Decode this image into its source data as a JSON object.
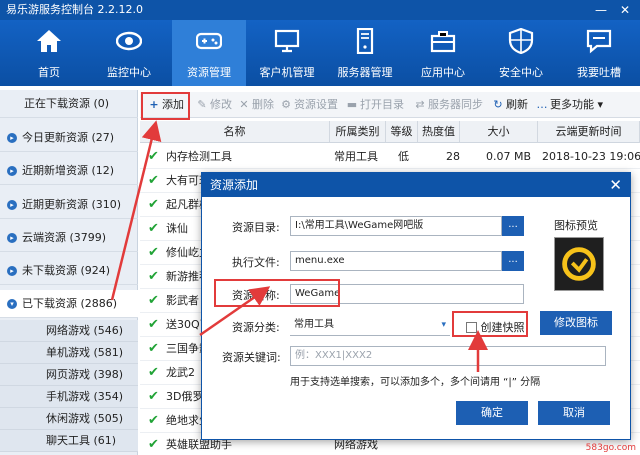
{
  "app": {
    "title": "易乐游服务控制台 2.2.12.0",
    "minimize": "—",
    "close": "✕"
  },
  "nav": [
    {
      "label": "首页",
      "icon": "home-icon"
    },
    {
      "label": "监控中心",
      "icon": "eye-icon"
    },
    {
      "label": "资源管理",
      "icon": "gamepad-icon"
    },
    {
      "label": "客户机管理",
      "icon": "monitor-icon"
    },
    {
      "label": "服务器管理",
      "icon": "server-icon"
    },
    {
      "label": "应用中心",
      "icon": "briefcase-icon"
    },
    {
      "label": "安全中心",
      "icon": "shield-icon"
    },
    {
      "label": "我要吐槽",
      "icon": "chat-icon"
    }
  ],
  "sidebar": {
    "items": [
      {
        "label": "正在下载资源 (0)",
        "kind": "header"
      },
      {
        "label": "今日更新资源 (27)"
      },
      {
        "label": "近期新增资源 (12)"
      },
      {
        "label": "近期更新资源 (310)"
      },
      {
        "label": "云端资源 (3799)"
      },
      {
        "label": "未下载资源 (924)"
      },
      {
        "label": "已下载资源 (2886)",
        "selected": true
      }
    ],
    "subitems": [
      {
        "label": "网络游戏 (546)"
      },
      {
        "label": "单机游戏 (581)"
      },
      {
        "label": "网页游戏 (398)"
      },
      {
        "label": "手机游戏 (354)"
      },
      {
        "label": "休闲游戏 (505)"
      },
      {
        "label": "聊天工具 (61)"
      }
    ]
  },
  "toolbar": {
    "add": "添加",
    "modify": "修改",
    "delete": "删除",
    "settings": "资源设置",
    "open_dir": "打开目录",
    "sync": "服务器同步",
    "refresh": "刷新",
    "more": "更多功能"
  },
  "table": {
    "columns": [
      "名称",
      "所属类别",
      "等级",
      "热度值",
      "大小",
      "云端更新时间"
    ],
    "rows": [
      {
        "name": "内存检测工具",
        "category": "常用工具",
        "level": "低",
        "heat": "28",
        "size": "0.07 MB",
        "time": "2018-10-23 19:06:2"
      },
      {
        "name": "大有可玩",
        "category": "",
        "level": "",
        "heat": "",
        "size": "",
        "time": ""
      },
      {
        "name": "起凡群雄",
        "category": "",
        "level": "",
        "heat": "",
        "size": "",
        "time": ""
      },
      {
        "name": "诛仙",
        "category": "",
        "level": "",
        "heat": "",
        "size": "",
        "time": ""
      },
      {
        "name": "修仙屹立",
        "category": "",
        "level": "",
        "heat": "",
        "size": "",
        "time": ""
      },
      {
        "name": "新游推荐",
        "category": "",
        "level": "",
        "heat": "",
        "size": "",
        "time": ""
      },
      {
        "name": "影武者",
        "category": "",
        "level": "",
        "heat": "",
        "size": "",
        "time": ""
      },
      {
        "name": "送30Q币",
        "category": "",
        "level": "",
        "heat": "",
        "size": "",
        "time": ""
      },
      {
        "name": "三国争霸",
        "category": "",
        "level": "",
        "heat": "",
        "size": "",
        "time": ""
      },
      {
        "name": "龙武2",
        "category": "",
        "level": "",
        "heat": "",
        "size": "",
        "time": ""
      },
      {
        "name": "3D俄罗斯",
        "category": "",
        "level": "",
        "heat": "",
        "size": "",
        "time": ""
      },
      {
        "name": "绝地求生",
        "category": "",
        "level": "",
        "heat": "",
        "size": "",
        "time": ""
      },
      {
        "name": "英雄联盟助手",
        "category": "网络游戏",
        "level": "",
        "heat": "",
        "size": "",
        "time": ""
      }
    ]
  },
  "dialog": {
    "title": "资源添加",
    "close": "✕",
    "dir_label": "资源目录:",
    "dir_value": "I:\\常用工具\\WeGame网吧版",
    "exe_label": "执行文件:",
    "exe_value": "menu.exe",
    "name_label": "资源名称:",
    "name_value": "WeGame",
    "category_label": "资源分类:",
    "category_value": "常用工具",
    "shortcut_label": "创建快照",
    "keyword_label": "资源关键词:",
    "keyword_placeholder": "例：XXX1|XXX2",
    "hint": "用于支持选单搜索，可以添加多个，多个间请用 “|” 分隔",
    "icon_preview_label": "图标预览",
    "change_icon": "修改图标",
    "ok": "确定",
    "cancel": "取消",
    "browse": "..."
  },
  "watermark": "583go.com",
  "colors": {
    "nav_bg": "#0e54a8",
    "accent": "#1d5fb3",
    "highlight": "#e23b3b",
    "check": "#21a336"
  }
}
